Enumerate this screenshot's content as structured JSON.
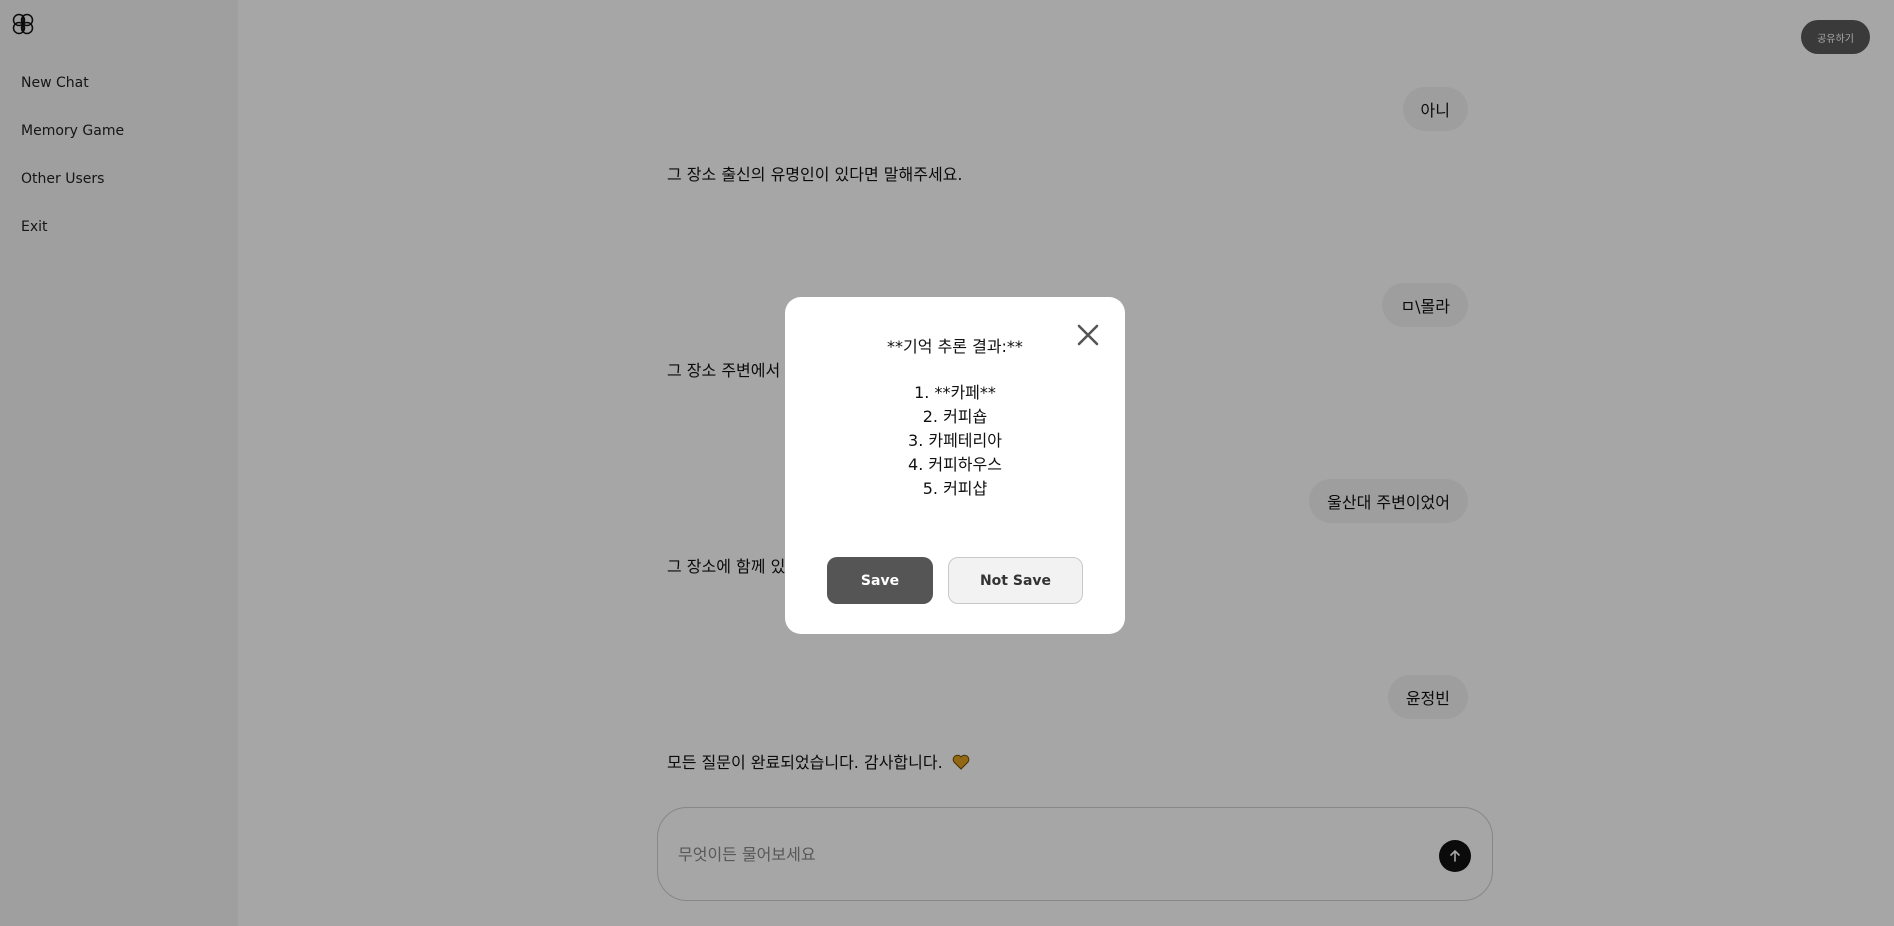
{
  "app": {
    "logo_icon": "brain-icon"
  },
  "sidebar": {
    "items": [
      {
        "label": "New Chat"
      },
      {
        "label": "Memory Game"
      },
      {
        "label": "Other Users"
      },
      {
        "label": "Exit"
      }
    ]
  },
  "header": {
    "share_label": "공유하기"
  },
  "chat": {
    "messages": [
      {
        "role": "user",
        "text": "아니"
      },
      {
        "role": "bot",
        "text": "그 장소 출신의 유명인이 있다면 말해주세요."
      },
      {
        "role": "user",
        "text": "ㅁ\\몰라"
      },
      {
        "role": "bot",
        "text": "그 장소 주변에서"
      },
      {
        "role": "user",
        "text": "울산대 주변이었어"
      },
      {
        "role": "bot",
        "text": "그 장소에 함께 있"
      },
      {
        "role": "user",
        "text": "윤정빈"
      },
      {
        "role": "bot",
        "text": "모든 질문이 완료되었습니다. 감사합니다.",
        "emoji_icon": "heart-icon"
      }
    ]
  },
  "composer": {
    "placeholder": "무엇이든 물어보세요",
    "send_icon": "arrow-up-icon"
  },
  "modal": {
    "title": "**기억 추론 결과:**",
    "results": [
      "1. **카페**",
      "2. 커피숍",
      "3. 카페테리아",
      "4. 커피하우스",
      "5. 커피샵"
    ],
    "save_label": "Save",
    "not_save_label": "Not Save",
    "close_icon": "close-icon"
  },
  "colors": {
    "overlay": "rgba(0,0,0,0.35)",
    "primary_button": "#555555",
    "sidebar_bg": "#f4f4f4"
  }
}
